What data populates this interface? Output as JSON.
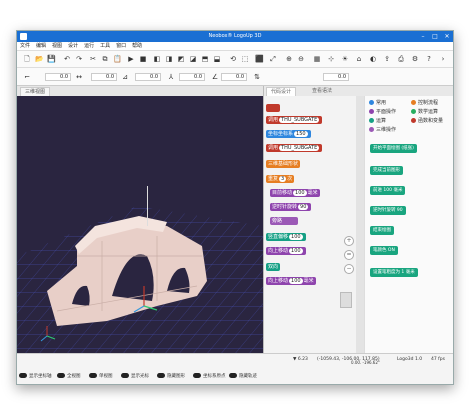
{
  "window": {
    "title": "Neobox® LogoUp 3D"
  },
  "menu": [
    "文件",
    "编辑",
    "视图",
    "设计",
    "运行",
    "工具",
    "窗口",
    "帮助"
  ],
  "toolbar": {
    "field1": "0.0",
    "field2": "0.0",
    "field3": "0.0",
    "field4": "0.0",
    "field5": "0.0",
    "field6": "0.0"
  },
  "left_tab": "三维视图",
  "right_tabs": [
    "代码设计",
    "查看语法"
  ],
  "categories": [
    {
      "label": "常用",
      "color": "#2e86de"
    },
    {
      "label": "控制流程",
      "color": "#e67e22"
    },
    {
      "label": "平面操作",
      "color": "#8e44ad"
    },
    {
      "label": "数学运算",
      "color": "#27ae60"
    },
    {
      "label": "运算",
      "color": "#16a085"
    },
    {
      "label": "函数和变量",
      "color": "#c0392b"
    },
    {
      "label": "三维操作",
      "color": "#9b59b6"
    }
  ],
  "blocks": {
    "b1": "THU_SUBGATE",
    "b2_a": "THU_SUBGATE",
    "b3": "坐标系",
    "b3v": "150",
    "b4": "THU_SUBGATE",
    "b5": "三维基础形状",
    "b6": "3",
    "b7": "目前移动",
    "b7v": "100",
    "b7u": "毫米",
    "b8": "逆时针旋转",
    "b8v": "90",
    "b9": "旁路",
    "b10": "竖直偏移",
    "b10v": "100",
    "b11": "向上移动",
    "b11v": "100",
    "b12": "双向",
    "b13": "向上移动",
    "b13v": "100",
    "b13u": "毫米"
  },
  "palette_blocks": [
    "开始平面绘图 (纸张)",
    "完成当前图形",
    "前进 100 毫米",
    "逆时针旋转 90",
    "结束绘图",
    "笔颜色 ON",
    "设置笔粗度为 1 毫米"
  ],
  "status": {
    "left": "▼ 6.23",
    "coords": "(-1059.43, -106.00, 117.85)",
    "center": "0.00, -196.62°",
    "right": "Logo3d 1.0",
    "zoom": "47 fps"
  },
  "toggles": [
    "显示坐标轴",
    "全视图",
    "单视图",
    "显示光标",
    "隐藏图形",
    "坐标系原点",
    "隐藏轨迹"
  ]
}
